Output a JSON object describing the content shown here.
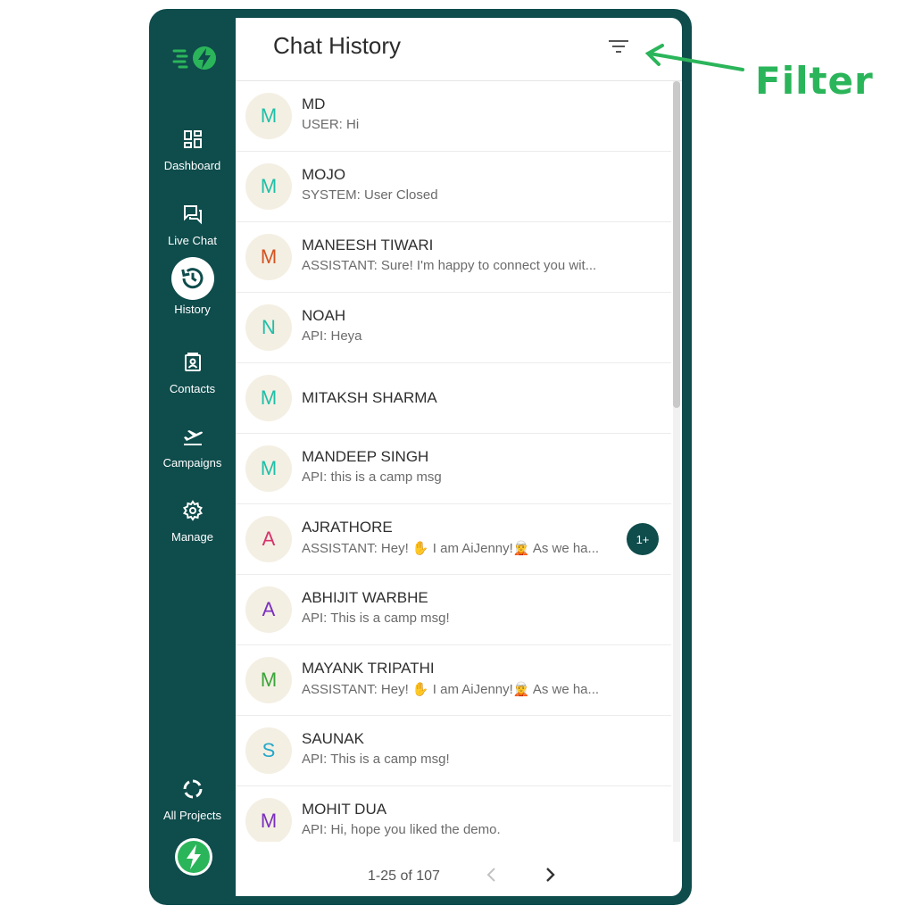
{
  "colors": {
    "sidebar_bg": "#0f4c4c",
    "accent_green": "#2bb55a",
    "badge_bg": "#0f4c4c"
  },
  "sidebar": {
    "logo": "bolt-logo-icon",
    "items": [
      {
        "label": "Dashboard",
        "icon": "dashboard-icon"
      },
      {
        "label": "Live Chat",
        "icon": "chat-icon"
      },
      {
        "label": "History",
        "icon": "history-icon",
        "active": true
      },
      {
        "label": "Contacts",
        "icon": "contact-card-icon"
      },
      {
        "label": "Campaigns",
        "icon": "plane-takeoff-icon"
      },
      {
        "label": "Manage",
        "icon": "gear-icon"
      }
    ],
    "bottom": {
      "label": "All Projects",
      "icon": "circle-segments-icon"
    },
    "project_avatar": "bolt-avatar-icon"
  },
  "header": {
    "title": "Chat History",
    "filter_icon": "filter-icon"
  },
  "chats": [
    {
      "initial": "M",
      "name": "MD",
      "preview": "USER: Hi",
      "color": "#1fbfa8"
    },
    {
      "initial": "M",
      "name": "MOJO",
      "preview": "SYSTEM: User Closed",
      "color": "#1fbfa8"
    },
    {
      "initial": "M",
      "name": "MANEESH TIWARI",
      "preview": "ASSISTANT: Sure! I'm happy to connect you wit...",
      "color": "#d4531f"
    },
    {
      "initial": "N",
      "name": "NOAH",
      "preview": "API: Heya",
      "color": "#1fbfa8"
    },
    {
      "initial": "M",
      "name": "MITAKSH SHARMA",
      "preview": "",
      "color": "#1fbfa8"
    },
    {
      "initial": "M",
      "name": "MANDEEP SINGH",
      "preview": "API: this is a camp msg",
      "color": "#1fbfa8"
    },
    {
      "initial": "A",
      "name": "AJRATHORE",
      "preview": "ASSISTANT: Hey! ✋ I am AiJenny!🧝 As we ha...",
      "color": "#d6336c",
      "badge": "1+"
    },
    {
      "initial": "A",
      "name": "ABHIJIT WARBHE",
      "preview": "API: This is a camp msg!",
      "color": "#7b2fbf"
    },
    {
      "initial": "M",
      "name": "MAYANK TRIPATHI",
      "preview": "ASSISTANT: Hey! ✋ I am AiJenny!🧝 As we ha...",
      "color": "#3aa53a"
    },
    {
      "initial": "S",
      "name": "SAUNAK",
      "preview": "API: This is a camp msg!",
      "color": "#23a8c9"
    },
    {
      "initial": "M",
      "name": "MOHIT DUA",
      "preview": "API: Hi, hope you liked the demo.",
      "color": "#7b2fbf"
    }
  ],
  "pager": {
    "text": "1-25 of 107",
    "prev_icon": "chevron-left-icon",
    "next_icon": "chevron-right-icon"
  },
  "annotation": {
    "label": "Filter",
    "icon": "arrow-left-icon"
  }
}
